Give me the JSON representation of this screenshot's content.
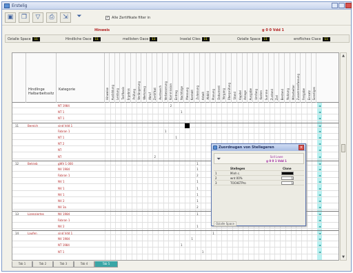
{
  "window": {
    "title": "Erstelig"
  },
  "toolbar": {
    "buttons": [
      "save-icon",
      "copy-icon",
      "filter-icon",
      "print-icon",
      "export-icon",
      "funnel-icon"
    ],
    "filter_label": "Alle Zertifikate filter in"
  },
  "groups": {
    "left": "Hinweis",
    "right": "g 0 0 Vdd 1"
  },
  "legend": [
    {
      "label": "Ozialle Space",
      "value": "11"
    },
    {
      "label": "Hindliche Oace",
      "value": "11"
    },
    {
      "label": "mellisten Oace",
      "value": "11"
    },
    {
      "label": "Inselal Clies",
      "value": "11"
    },
    {
      "label": "Ozialle Space",
      "value": "11"
    },
    {
      "label": "erofliches Clace",
      "value": "11"
    }
  ],
  "columns": {
    "first": "Hindlinge Halbarbeitssitz",
    "second": "Kategorie"
  },
  "vertical_headers": [
    "Hinweise",
    "Ausbildung",
    "Leistung",
    "Tarifbasis",
    "Ergebnis",
    "Prüfung",
    "Verlängerung",
    "Werkzeug",
    "Abruf",
    "Zertifikat",
    "Austausch",
    "Verbesserung",
    "Kommission",
    "Eintrag",
    "Nachfolge",
    "Messung",
    "Kontakt",
    "Zulassung",
    "Arbeit",
    "Abbild",
    "Planung",
    "Dokument",
    "Vorgang",
    "Überprüfung",
    "Stand",
    "Kapitel",
    "Anlage",
    "Ausgabe",
    "Umfang",
    "Kosten",
    "Summe",
    "Zustand",
    "Ziel",
    "Bestand",
    "Nutzung",
    "Mitarbeiter",
    "Zusammenfassung",
    "Freigabe",
    "Einsatz",
    "Sonstiges"
  ],
  "rows": [
    {
      "num": "",
      "cat": "",
      "item": "NT 1984"
    },
    {
      "num": "",
      "cat": "",
      "item": "NT 1"
    },
    {
      "num": "",
      "cat": "",
      "item": "NT 1"
    },
    {
      "num": "11",
      "cat": "Bereich",
      "item": "sind Vdd 1"
    },
    {
      "num": "",
      "cat": "",
      "item": "Fabran 1"
    },
    {
      "num": "",
      "cat": "",
      "item": "NT 1"
    },
    {
      "num": "",
      "cat": "",
      "item": "NT 2"
    },
    {
      "num": "",
      "cat": "",
      "item": "NT"
    },
    {
      "num": "",
      "cat": "",
      "item": "NT"
    },
    {
      "num": "12",
      "cat": "Betrieb",
      "item": "gWV 1 000"
    },
    {
      "num": "",
      "cat": "",
      "item": "NV 1984"
    },
    {
      "num": "",
      "cat": "",
      "item": "Fabran 1"
    },
    {
      "num": "",
      "cat": "",
      "item": "NV 1"
    },
    {
      "num": "",
      "cat": "",
      "item": "NV 1"
    },
    {
      "num": "",
      "cat": "",
      "item": "NV 1"
    },
    {
      "num": "",
      "cat": "",
      "item": "NV 2"
    },
    {
      "num": "",
      "cat": "",
      "item": "NV 3a"
    },
    {
      "num": "13",
      "cat": "Lizenziertes",
      "item": "NV 1984"
    },
    {
      "num": "",
      "cat": "",
      "item": "Fabran 1"
    },
    {
      "num": "",
      "cat": "",
      "item": "NV 2"
    },
    {
      "num": "14",
      "cat": "Laufen",
      "item": "sind Vdd 1"
    },
    {
      "num": "",
      "cat": "",
      "item": "NV 1984"
    },
    {
      "num": "",
      "cat": "",
      "item": "NT 1984"
    },
    {
      "num": "",
      "cat": "",
      "item": "NT 1"
    }
  ],
  "tabs": [
    "Tab 1",
    "Tab 2",
    "Tab 3",
    "Tab 4",
    "Tab 5"
  ],
  "popup": {
    "title": "Zuordnugen von Stellegeren",
    "sub1": "Soll Lewe",
    "sub2": "g 0 0 1 Vdd 1",
    "col1": "Stellegen",
    "col2": "Clone",
    "rows": [
      {
        "n": "1",
        "name": "Minh c.",
        "val": ""
      },
      {
        "n": "2",
        "name": "wnt 00%",
        "val": "1"
      },
      {
        "n": "3",
        "name": "TOCHETPro",
        "val": "1"
      }
    ],
    "footer": "Ozialle Space"
  }
}
